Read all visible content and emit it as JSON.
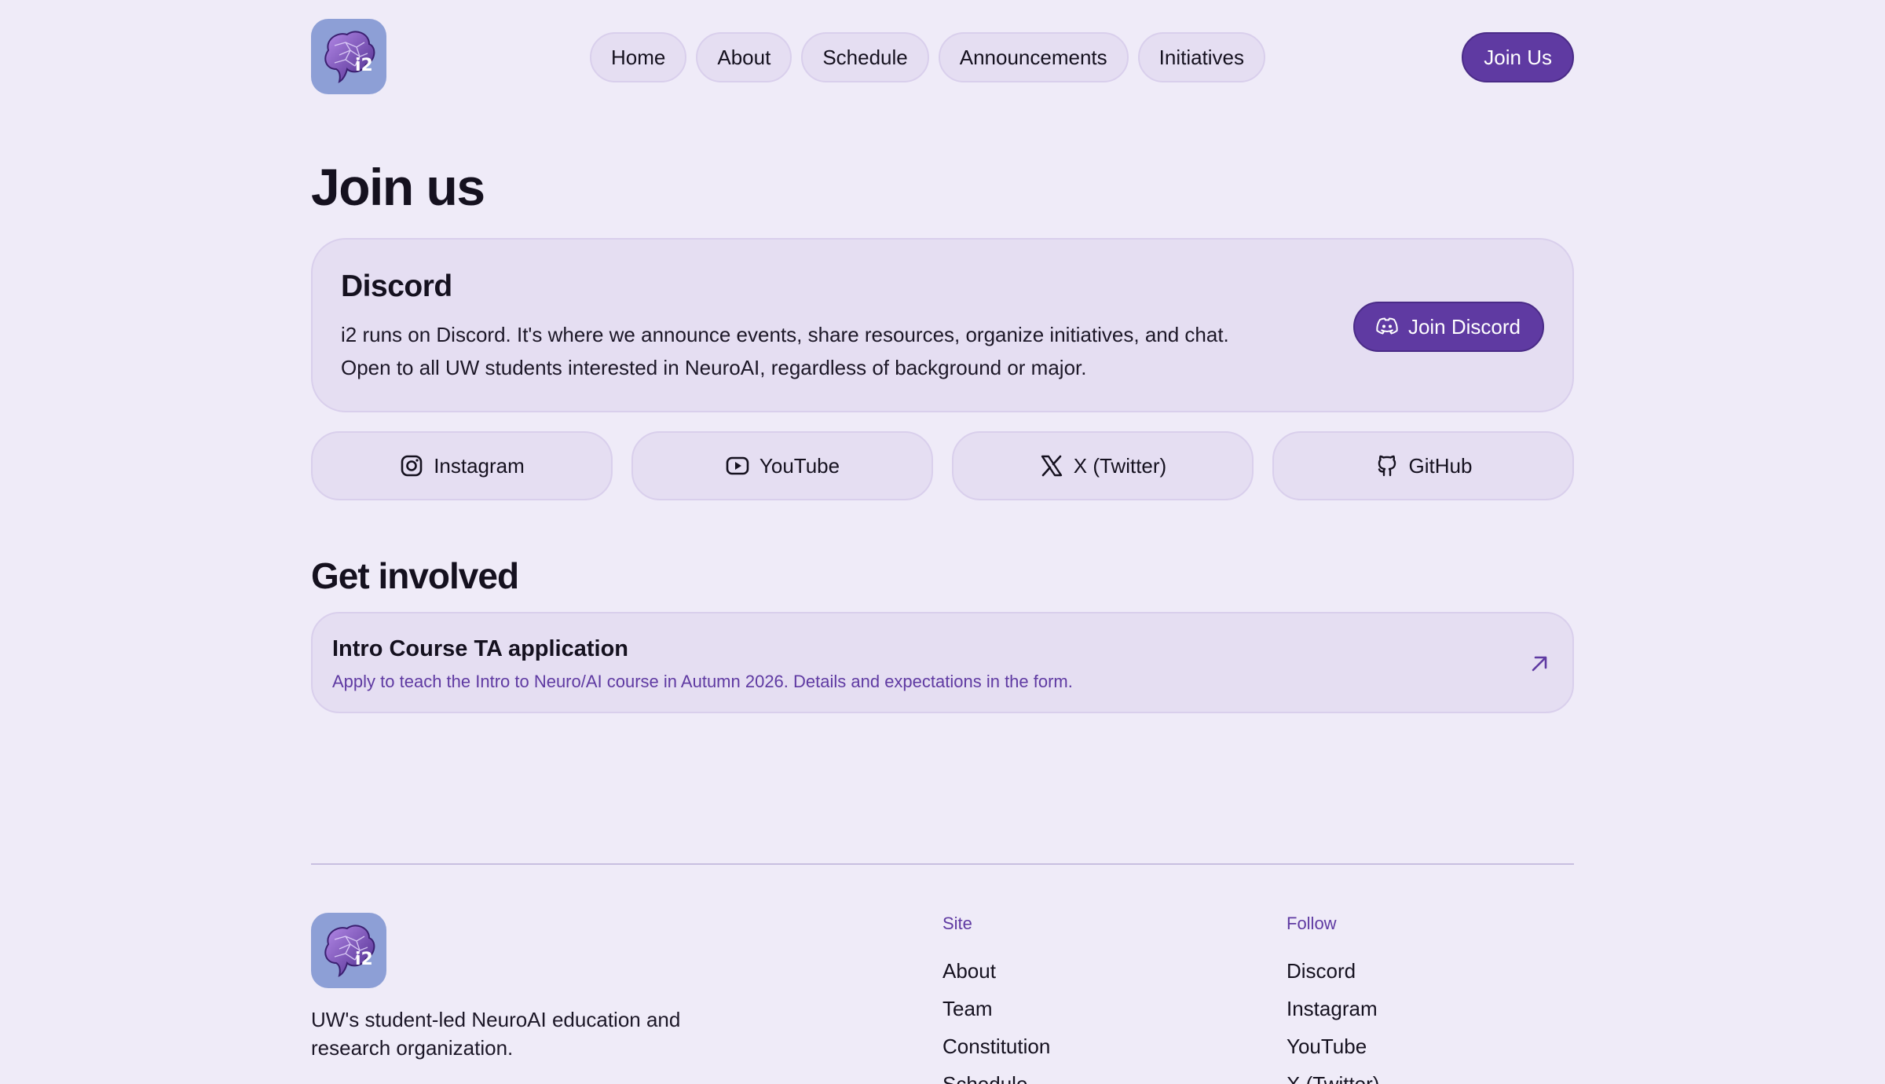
{
  "header": {
    "logo_text": "i2",
    "nav": [
      "Home",
      "About",
      "Schedule",
      "Announcements",
      "Initiatives"
    ],
    "join_label": "Join Us"
  },
  "page_title": "Join us",
  "discord": {
    "title": "Discord",
    "description": "i2 runs on Discord. It's where we announce events, share resources, organize initiatives, and chat. Open to all UW students interested in NeuroAI, regardless of background or major.",
    "button_label": "Join Discord"
  },
  "socials": [
    {
      "label": "Instagram",
      "icon": "instagram-icon"
    },
    {
      "label": "YouTube",
      "icon": "youtube-icon"
    },
    {
      "label": "X (Twitter)",
      "icon": "x-icon"
    },
    {
      "label": "GitHub",
      "icon": "github-icon"
    }
  ],
  "get_involved": {
    "title": "Get involved",
    "items": [
      {
        "title": "Intro Course TA application",
        "description": "Apply to teach the Intro to Neuro/AI course in Autumn 2026. Details and expectations in the form.",
        "icon": "external-arrow-icon"
      }
    ]
  },
  "footer": {
    "tagline": "UW's student-led NeuroAI education and research organization.",
    "site_heading": "Site",
    "site_links": [
      "About",
      "Team",
      "Constitution",
      "Schedule"
    ],
    "follow_heading": "Follow",
    "follow_links": [
      "Discord",
      "Instagram",
      "YouTube",
      "X (Twitter)"
    ]
  },
  "colors": {
    "background": "#efebf8",
    "card": "#e5def2",
    "accent": "#5f3aa2",
    "text": "#15111f"
  }
}
